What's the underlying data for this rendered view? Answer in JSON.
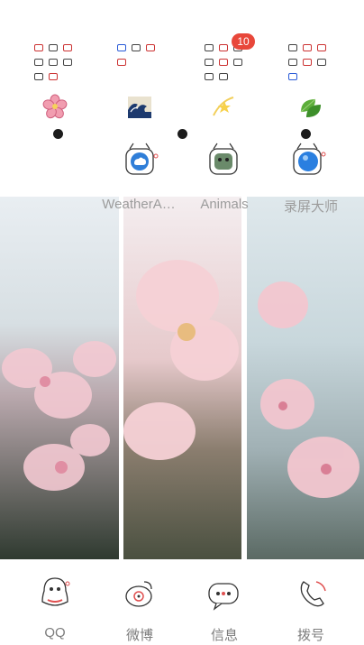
{
  "folders": [
    {
      "name": "folder-1"
    },
    {
      "name": "folder-2"
    },
    {
      "name": "folder-3",
      "badge": "10"
    },
    {
      "name": "folder-4"
    }
  ],
  "top_apps": [
    {
      "label": "WeatherA…",
      "icon": "weather-cloud-icon"
    },
    {
      "label": "Animals",
      "icon": "animals-icon"
    },
    {
      "label": "录屏大师",
      "icon": "screen-recorder-icon"
    }
  ],
  "dock": [
    {
      "label": "QQ",
      "icon": "qq-icon"
    },
    {
      "label": "微博",
      "icon": "weibo-icon"
    },
    {
      "label": "信息",
      "icon": "messages-icon"
    },
    {
      "label": "拨号",
      "icon": "dialer-icon"
    }
  ],
  "colors": {
    "badge": "#e8473a",
    "label_top": "#9c9c9c",
    "label_bottom": "#7c7c7c"
  }
}
